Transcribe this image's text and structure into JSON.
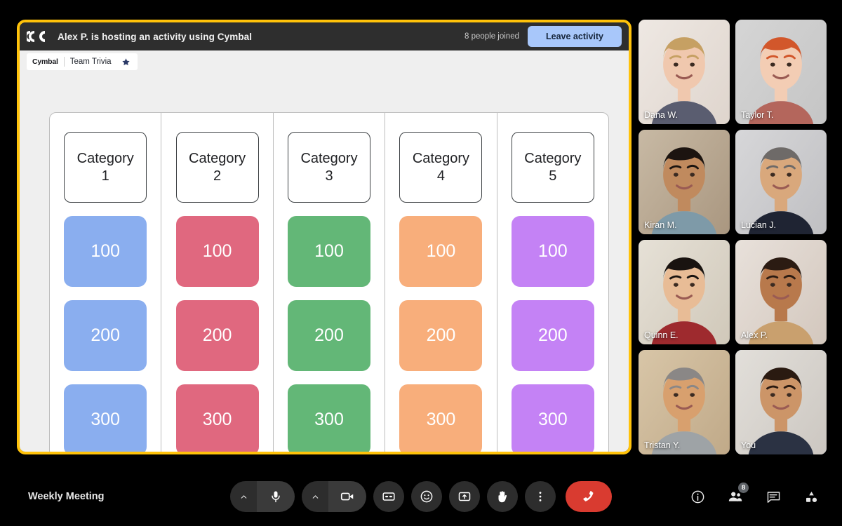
{
  "activity": {
    "logo_icon": "cymbal-logo-icon",
    "host_banner": "Alex P. is hosting an activity using Cymbal",
    "joined_count_label": "8 people joined",
    "leave_label": "Leave activity",
    "tab": {
      "brand": "Cymbal",
      "name": "Team Trivia",
      "star_icon": "star-icon"
    },
    "frame_color": "#FFC20A",
    "leave_button_color": "#A8C7FA"
  },
  "board": {
    "columns": [
      {
        "category": "Category 1",
        "color": "#8AAEEF",
        "values": [
          "100",
          "200",
          "300"
        ]
      },
      {
        "category": "Category 2",
        "color": "#E0687F",
        "values": [
          "100",
          "200",
          "300"
        ]
      },
      {
        "category": "Category 3",
        "color": "#63B777",
        "values": [
          "100",
          "200",
          "300"
        ]
      },
      {
        "category": "Category 4",
        "color": "#F8AE7B",
        "values": [
          "100",
          "200",
          "300"
        ]
      },
      {
        "category": "Category 5",
        "color": "#C482F5",
        "values": [
          "100",
          "200",
          "300"
        ]
      }
    ]
  },
  "participants": [
    {
      "name": "Dana W.",
      "self": false
    },
    {
      "name": "Taylor T.",
      "self": false
    },
    {
      "name": "Kiran M.",
      "self": false
    },
    {
      "name": "Lucian J.",
      "self": false
    },
    {
      "name": "Quinn E.",
      "self": false
    },
    {
      "name": "Alex P.",
      "self": false
    },
    {
      "name": "Tristan Y.",
      "self": false
    },
    {
      "name": "You",
      "self": true
    }
  ],
  "bottom_bar": {
    "meeting_name": "Weekly Meeting",
    "controls": [
      {
        "icon": "microphone-icon",
        "has_caret": true
      },
      {
        "icon": "camera-icon",
        "has_caret": true
      },
      {
        "icon": "captions-icon",
        "has_caret": false
      },
      {
        "icon": "emoji-reaction-icon",
        "has_caret": false
      },
      {
        "icon": "present-screen-icon",
        "has_caret": false
      },
      {
        "icon": "raise-hand-icon",
        "has_caret": false
      },
      {
        "icon": "more-options-icon",
        "has_caret": false
      }
    ],
    "hangup_icon": "end-call-icon",
    "right_controls": [
      {
        "icon": "info-icon",
        "badge": ""
      },
      {
        "icon": "people-icon",
        "badge": "8"
      },
      {
        "icon": "chat-icon",
        "badge": ""
      },
      {
        "icon": "activities-icon",
        "badge": ""
      }
    ]
  }
}
